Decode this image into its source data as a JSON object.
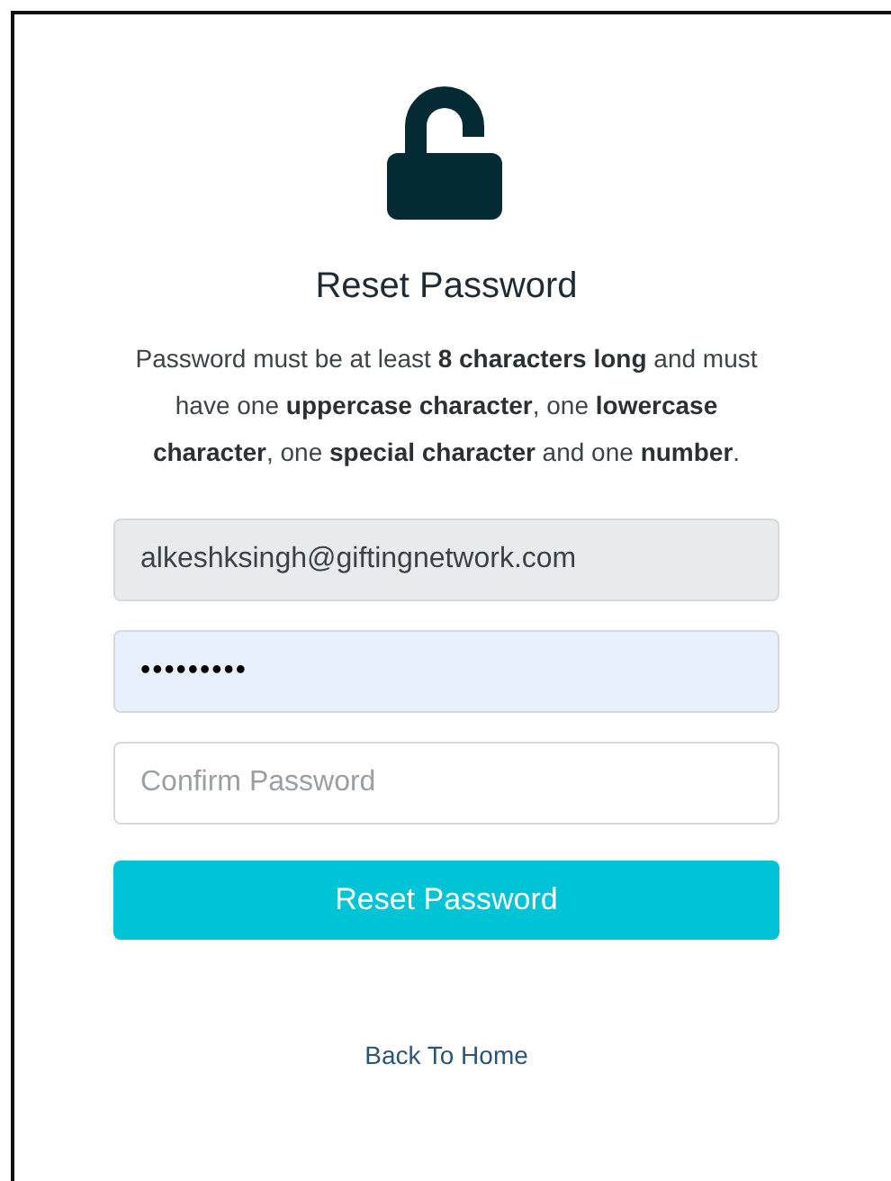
{
  "title": "Reset Password",
  "instructions": "Password must be at least **8 characters long** and must have one **uppercase character**, one **lowercase character**, one **special character** and one **number**.",
  "fields": [
    {
      "value": "alkeshksingh@giftingnetwork.com",
      "disabled": true,
      "autofilled": false
    },
    {
      "value": "•••••••••",
      "disabled": false,
      "autofilled": true
    },
    {
      "placeholder": "Confirm Password",
      "disabled": false,
      "autofilled": false
    }
  ],
  "submit_button": "Reset Password",
  "back_link": "Back To Home"
}
